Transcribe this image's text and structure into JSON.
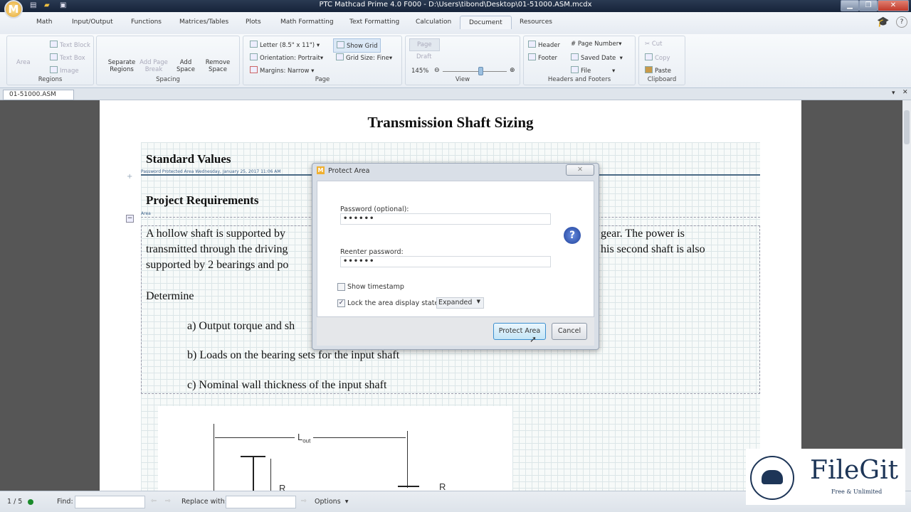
{
  "window": {
    "title": "PTC Mathcad Prime 4.0 F000 - D:\\Users\\tibond\\Desktop\\01-51000.ASM.mcdx",
    "logo": "M",
    "minimize": "▁",
    "restore": "❐",
    "close": "✕"
  },
  "tabs": [
    "Math",
    "Input/Output",
    "Functions",
    "Matrices/Tables",
    "Plots",
    "Math Formatting",
    "Text Formatting",
    "Calculation",
    "Document",
    "Resources"
  ],
  "active_tab": "Document",
  "ribbon": {
    "regions": {
      "label": "Regions",
      "area": "Area",
      "text_block": "Text Block",
      "text_box": "Text Box",
      "image": "Image"
    },
    "spacing": {
      "label": "Spacing",
      "separate": "Separate Regions",
      "page_break": "Add Page Break",
      "add_space": "Add Space",
      "remove_space": "Remove Space"
    },
    "page": {
      "label": "Page",
      "size": "Letter (8.5\" x 11\")",
      "orientation_label": "Orientation:",
      "orientation": "Portrait",
      "margins_label": "Margins:",
      "margins": "Narrow",
      "show_grid": "Show Grid",
      "grid_size_label": "Grid Size:",
      "grid_size": "Fine"
    },
    "view": {
      "label": "View",
      "page": "Page",
      "draft": "Draft",
      "zoom": "145%"
    },
    "headers": {
      "label": "Headers and Footers",
      "header": "Header",
      "footer": "Footer",
      "page_number": "Page Number",
      "saved_date": "Saved Date",
      "file": "File"
    },
    "clipboard": {
      "label": "Clipboard",
      "cut": "Cut",
      "copy": "Copy",
      "paste": "Paste"
    }
  },
  "doc_tab": "01-51000.ASM",
  "document": {
    "title": "Transmission Shaft Sizing",
    "h1": "Standard Values",
    "protected_note": "Password Protected Area  Wednesday, January 25, 2017 11:06 AM",
    "h2": "Project Requirements",
    "area_label": "Area",
    "lines": [
      "A hollow shaft  is supported by",
      "gear.  The power is",
      "transmitted through the driving",
      "his second shaft is also",
      "supported by 2 bearings and po"
    ],
    "determine": "Determine",
    "items": [
      "a) Output torque and sh",
      "b) Loads on the bearing sets for the input shaft",
      "c) Nominal wall thickness of the input shaft"
    ],
    "diagram": {
      "l_out": "L",
      "l_out_sub": "out",
      "r1": "R",
      "r2": "R"
    }
  },
  "dialog": {
    "title": "Protect Area",
    "password_label": "Password (optional):",
    "password": "••••••",
    "reenter_label": "Reenter password:",
    "reenter": "••••••",
    "show_timestamp": "Show timestamp",
    "show_timestamp_checked": false,
    "lock_label": "Lock the area display state:",
    "lock_checked": true,
    "lock_state": "Expanded",
    "protect_button": "Protect Area",
    "cancel_button": "Cancel"
  },
  "status": {
    "page": "1 / 5",
    "find_label": "Find:",
    "replace_label": "Replace with:",
    "options": "Options"
  },
  "watermark": {
    "name": "FileGit",
    "tagline": "Free & Unlimited"
  }
}
